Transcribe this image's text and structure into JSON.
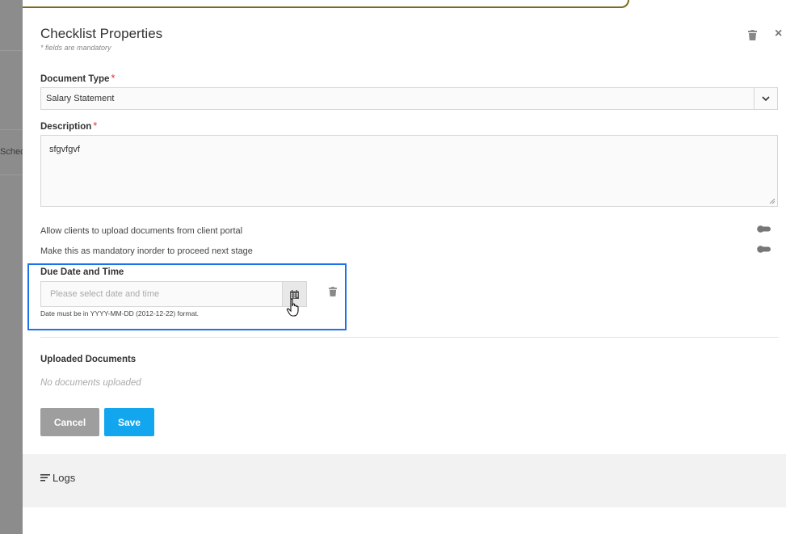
{
  "background": {
    "partial_tab_label": "Sched"
  },
  "panel": {
    "title": "Checklist Properties",
    "subtitle": "* fields are mandatory",
    "close_glyph": "×"
  },
  "document_type": {
    "label": "Document Type",
    "required_mark": "*",
    "selected_value": "Salary Statement"
  },
  "description": {
    "label": "Description",
    "required_mark": "*",
    "value": "sfgvfgvf"
  },
  "toggles": [
    {
      "label": "Allow clients to upload documents from client portal",
      "on": false
    },
    {
      "label": "Make this as mandatory inorder to proceed next stage",
      "on": false
    }
  ],
  "due_date": {
    "label": "Due Date and Time",
    "placeholder": "Please select date and time",
    "hint": "Date must be in YYYY-MM-DD (2012-12-22) format."
  },
  "uploaded_documents": {
    "label": "Uploaded Documents",
    "empty_text": "No documents uploaded"
  },
  "buttons": {
    "cancel": "Cancel",
    "save": "Save"
  },
  "logs": {
    "label": "Logs"
  },
  "colors": {
    "accent": "#12a6ee",
    "highlight_border": "#1a73e8",
    "required": "#e0333b",
    "cancel": "#9e9e9e"
  }
}
